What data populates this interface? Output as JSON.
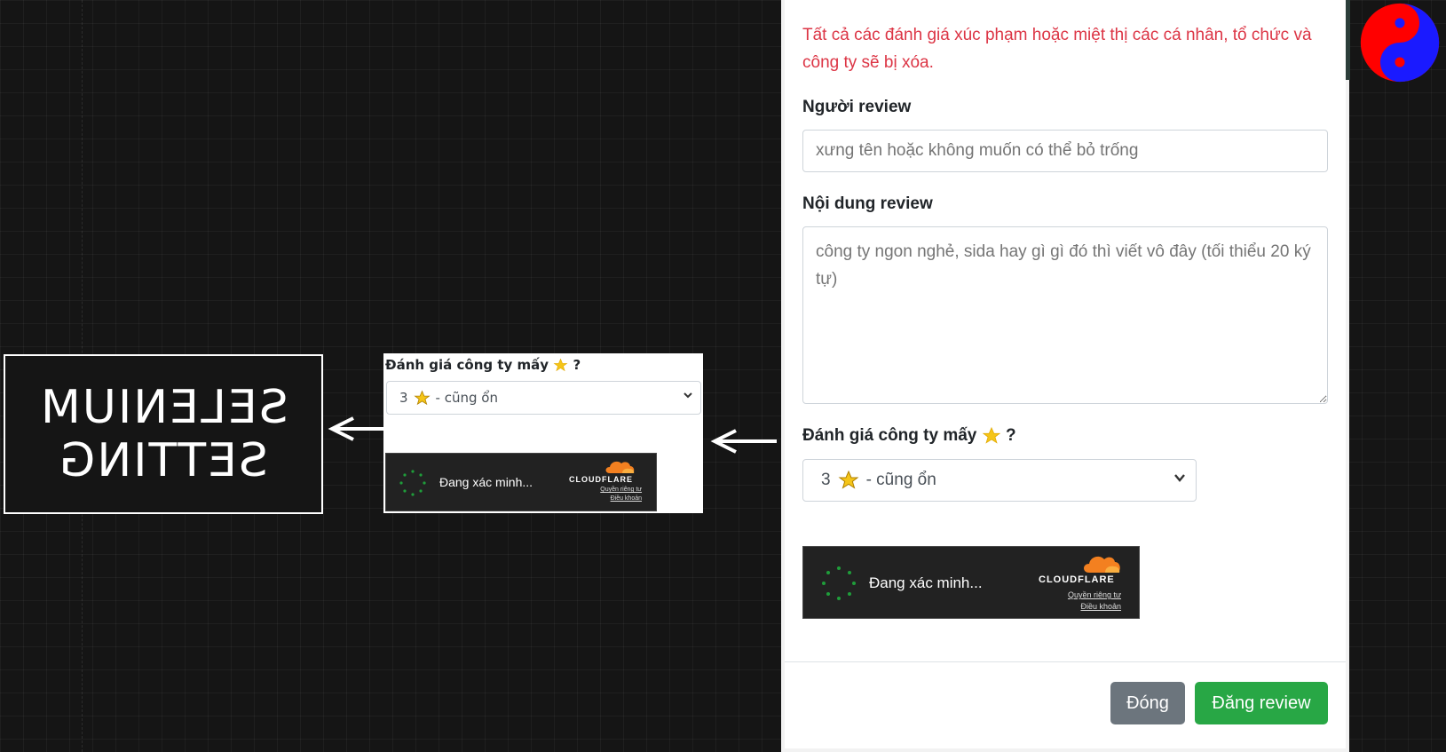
{
  "label": {
    "line1": "SELENIUM",
    "line2": "SETTING"
  },
  "crop": {
    "question": "Đánh giá công ty mấy",
    "question_mark": "?",
    "select_value": "3",
    "select_rest": "- cũng ổn",
    "cf_status": "Đang xác minh...",
    "cf_brand": "CLOUDFLARE",
    "cf_privacy": "Quyền riêng tư",
    "cf_terms": "Điều khoản"
  },
  "modal": {
    "warning": "Tất cả các đánh giá xúc phạm hoặc miệt thị các cá nhân, tổ chức và công ty sẽ bị xóa.",
    "reviewer_label": "Người review",
    "reviewer_placeholder": "xưng tên hoặc không muốn có thể bỏ trống",
    "content_label": "Nội dung review",
    "content_placeholder": "công ty ngon nghẻ, sida hay gì gì đó thì viết vô đây (tối thiểu 20 ký tự)",
    "rating_label": "Đánh giá công ty mấy",
    "rating_question_mark": "?",
    "rating_value": "3",
    "rating_rest": "- cũng ổn",
    "cf_status": "Đang xác minh...",
    "cf_brand": "CLOUDFLARE",
    "cf_privacy": "Quyền riêng tư",
    "cf_terms": "Điều khoản",
    "close_button": "Đóng",
    "submit_button": "Đăng review"
  },
  "colors": {
    "warning": "#dc3545",
    "submit": "#28a745",
    "close": "#6c757d",
    "cloudflare_orange": "#f38020",
    "spinner": "#1f9d3a"
  },
  "icons": [
    "star-icon",
    "chevron-down-icon",
    "cloudflare-logo-icon",
    "spinner-icon",
    "yin-yang-icon",
    "arrow-left-icon",
    "resize-grip-icon"
  ]
}
